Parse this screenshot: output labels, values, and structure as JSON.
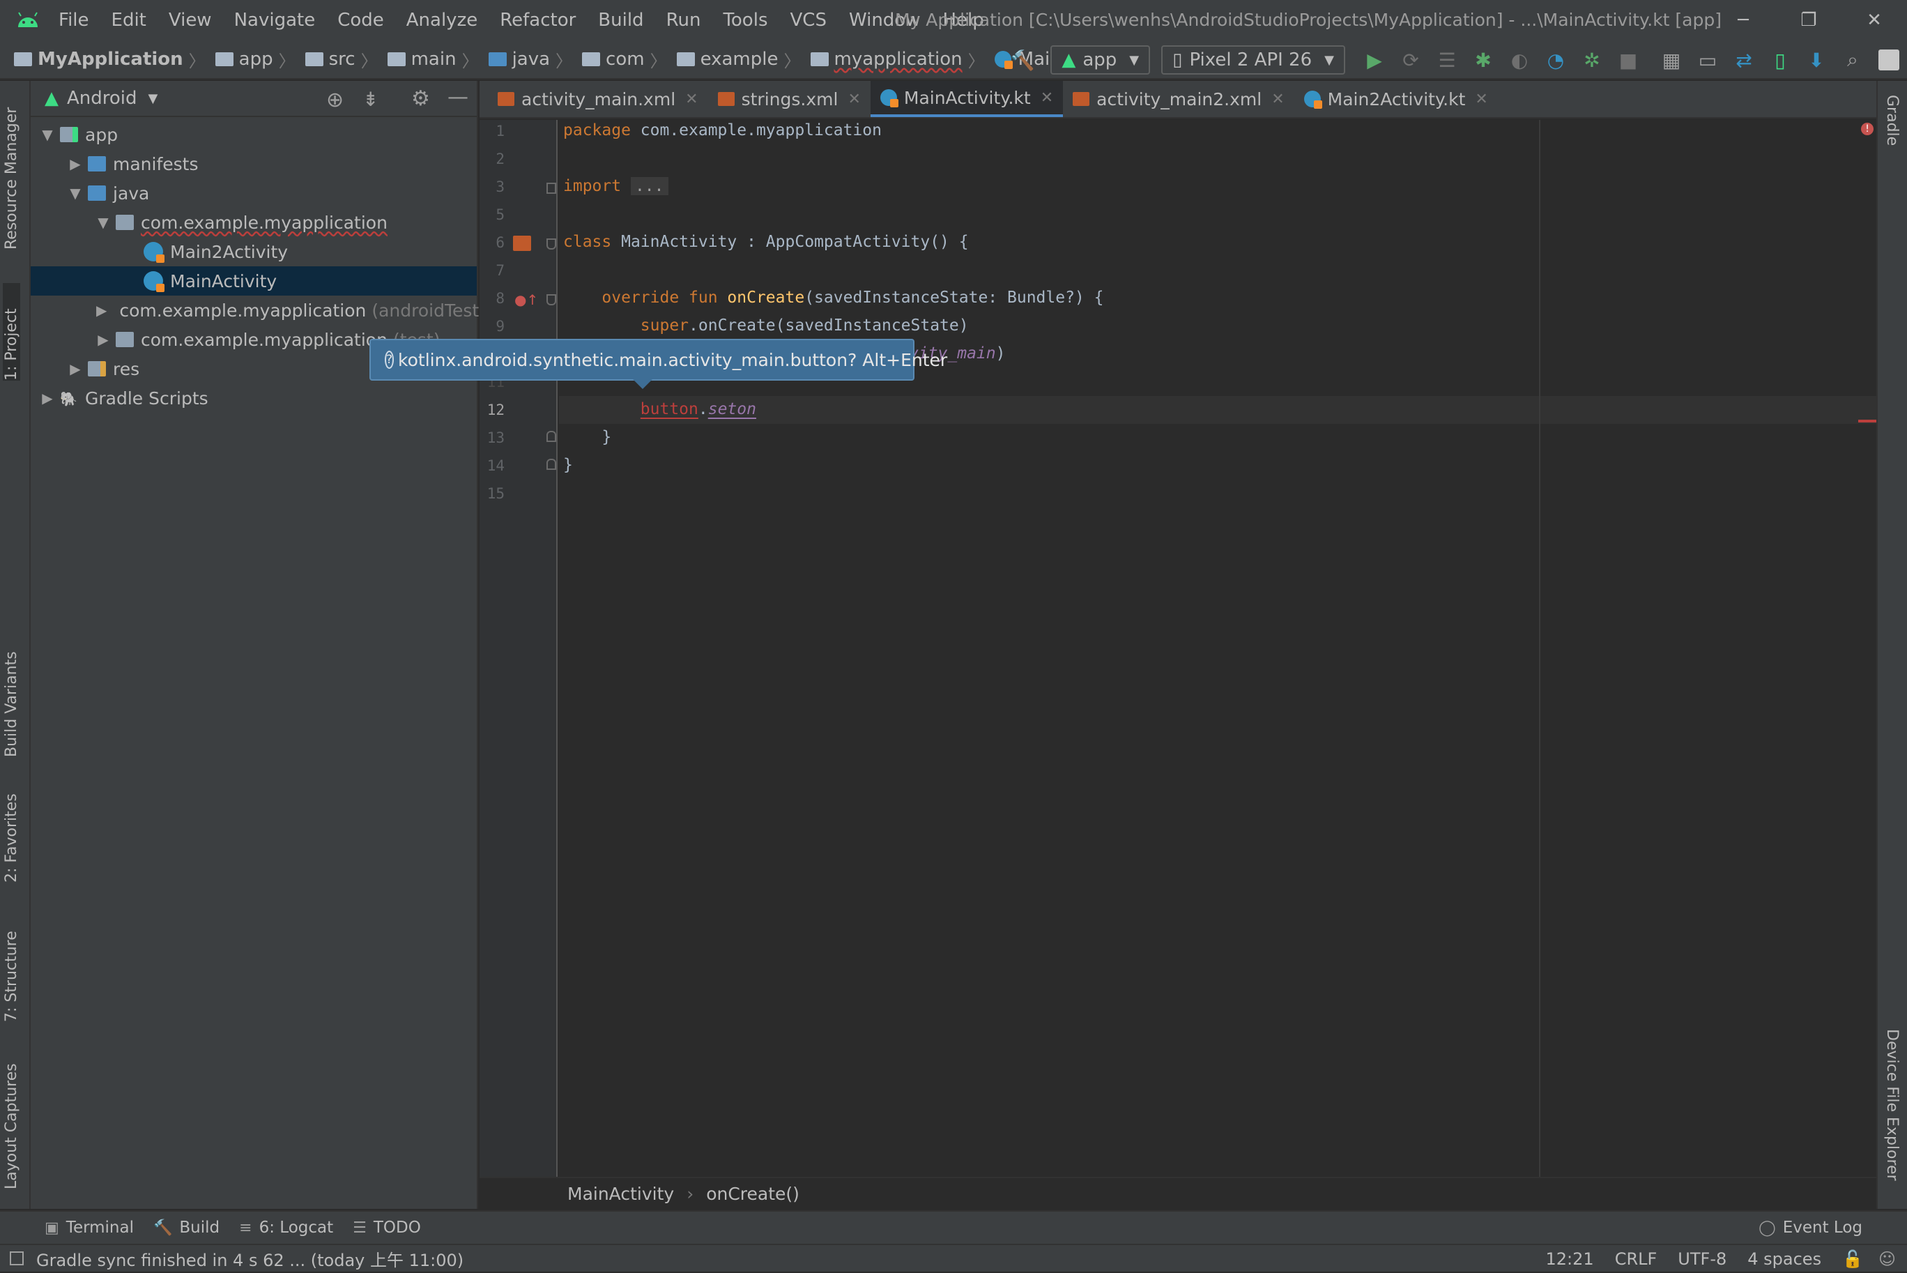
{
  "window": {
    "title": "My Application [C:\\Users\\wenhs\\AndroidStudioProjects\\MyApplication] - ...\\MainActivity.kt [app]",
    "controls": [
      "─",
      "❐",
      "✕"
    ]
  },
  "menu": [
    "File",
    "Edit",
    "View",
    "Navigate",
    "Code",
    "Analyze",
    "Refactor",
    "Build",
    "Run",
    "Tools",
    "VCS",
    "Window",
    "Help"
  ],
  "breadcrumb": [
    "MyApplication",
    "app",
    "src",
    "main",
    "java",
    "com",
    "example",
    "myapplication",
    "MainActivity"
  ],
  "toolbar": {
    "run_config": "app",
    "device": "Pixel 2 API 26"
  },
  "left_tool_tabs": [
    "Resource Manager",
    "1: Project",
    "Build Variants",
    "2: Favorites",
    "7: Structure",
    "Layout Captures"
  ],
  "right_tool_tabs": [
    "Gradle",
    "Device File Explorer"
  ],
  "project": {
    "view": "Android",
    "tree": [
      {
        "label": "app",
        "suffix": "",
        "depth": 0,
        "arrow": "▼",
        "icon": "module-folder-icon"
      },
      {
        "label": "manifests",
        "suffix": "",
        "depth": 1,
        "arrow": "▶",
        "icon": "folder-icon"
      },
      {
        "label": "java",
        "suffix": "",
        "depth": 1,
        "arrow": "▼",
        "icon": "folder-icon"
      },
      {
        "label": "com.example.myapplication",
        "suffix": "",
        "depth": 2,
        "arrow": "▼",
        "icon": "package-icon",
        "error": true
      },
      {
        "label": "Main2Activity",
        "suffix": "",
        "depth": 3,
        "arrow": "",
        "icon": "kotlin-class-icon"
      },
      {
        "label": "MainActivity",
        "suffix": "",
        "depth": 3,
        "arrow": "",
        "icon": "kotlin-class-icon",
        "selected": true
      },
      {
        "label": "com.example.myapplication",
        "suffix": "(androidTest)",
        "depth": 2,
        "arrow": "▶",
        "icon": "package-icon"
      },
      {
        "label": "com.example.myapplication",
        "suffix": "(test)",
        "depth": 2,
        "arrow": "▶",
        "icon": "package-icon"
      },
      {
        "label": "res",
        "suffix": "",
        "depth": 1,
        "arrow": "▶",
        "icon": "res-folder-icon"
      },
      {
        "label": "Gradle Scripts",
        "suffix": "",
        "depth": 0,
        "arrow": "▶",
        "icon": "gradle-icon"
      }
    ]
  },
  "tabs": [
    {
      "label": "activity_main.xml",
      "icon": "xml-layout-icon",
      "active": false
    },
    {
      "label": "strings.xml",
      "icon": "xml-layout-icon",
      "active": false
    },
    {
      "label": "MainActivity.kt",
      "icon": "kotlin-class-icon",
      "active": true
    },
    {
      "label": "activity_main2.xml",
      "icon": "xml-layout-icon",
      "active": false
    },
    {
      "label": "Main2Activity.kt",
      "icon": "kotlin-class-icon",
      "active": false
    }
  ],
  "editor": {
    "line_numbers": [
      "1",
      "2",
      "3",
      "5",
      "6",
      "7",
      "8",
      "9",
      "11",
      "12",
      "13",
      "14",
      "15"
    ],
    "current_line": "12",
    "code": {
      "l1_kw": "package",
      "l1_rest": " com.example.myapplication",
      "l3_kw": "import",
      "l3_fold": "...",
      "l6_kw": "class",
      "l6_rest": " MainActivity : AppCompatActivity() {",
      "l8_kw": "override fun",
      "l8_fn": "onCreate",
      "l8_rest": "(savedInstanceState: Bundle?) {",
      "l9_kw": "super",
      "l9_rest": ".onCreate(savedInstanceState)",
      "l10_hidden": "vity_main",
      "l10_close": ")",
      "l12_err": "button",
      "l12_dot": ".",
      "l12_it": "seton",
      "l13": "}",
      "l14": "}"
    },
    "tooltip": "kotlinx.android.synthetic.main.activity_main.button? Alt+Enter"
  },
  "editor_breadcrumb": [
    "MainActivity",
    "onCreate()"
  ],
  "bottom_tools": [
    {
      "label": "Terminal",
      "icon": "terminal-icon"
    },
    {
      "label": "Build",
      "icon": "hammer-icon"
    },
    {
      "label": "6: Logcat",
      "icon": "logcat-icon"
    },
    {
      "label": "TODO",
      "icon": "todo-icon"
    }
  ],
  "event_log": "Event Log",
  "status": {
    "message": "Gradle sync finished in 4 s 62 ... (today 上午 11:00)",
    "position": "12:21",
    "line_sep": "CRLF",
    "encoding": "UTF-8",
    "indent": "4 spaces"
  },
  "colors": {
    "accent": "#4a88c7",
    "error": "#bc3f3c",
    "keyword": "#cc7832",
    "function": "#ffc66d",
    "android_green": "#3ddc84"
  }
}
